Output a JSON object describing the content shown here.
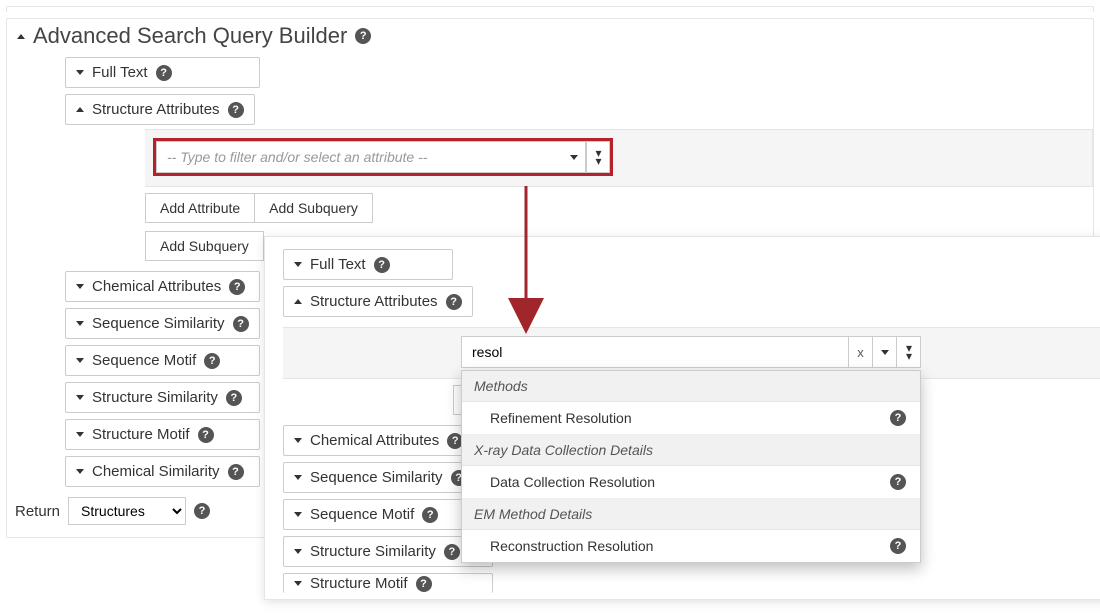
{
  "main_title": "Advanced Search Query Builder",
  "sections": {
    "full_text": "Full Text",
    "structure_attributes": "Structure Attributes",
    "chemical_attributes": "Chemical Attributes",
    "sequence_similarity": "Sequence Similarity",
    "sequence_motif": "Sequence Motif",
    "structure_similarity": "Structure Similarity",
    "structure_motif": "Structure Motif",
    "chemical_similarity": "Chemical Similarity"
  },
  "filter": {
    "placeholder": "-- Type to filter and/or select an attribute --"
  },
  "buttons": {
    "add_attribute": "Add Attribute",
    "add_subquery": "Add Subquery",
    "add_subqu_cut": "Add Subqu"
  },
  "return": {
    "label": "Return",
    "selected": "Structures"
  },
  "typeahead": {
    "value": "resol",
    "clear": "x",
    "groups": [
      {
        "label": "Methods",
        "items": [
          "Refinement Resolution"
        ]
      },
      {
        "label": "X-ray Data Collection Details",
        "items": [
          "Data Collection Resolution"
        ]
      },
      {
        "label": "EM Method Details",
        "items": [
          "Reconstruction Resolution"
        ]
      }
    ]
  },
  "arrow_color": "#a0262c"
}
